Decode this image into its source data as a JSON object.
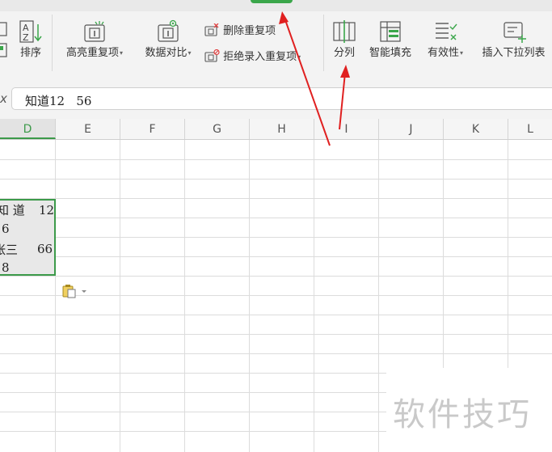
{
  "ribbon": {
    "sort_label": "排序",
    "highlight_dup_label": "高亮重复项",
    "data_compare_label": "数据对比",
    "delete_dup_label": "删除重复项",
    "reject_dup_label": "拒绝录入重复项",
    "split_column_label": "分列",
    "smart_fill_label": "智能填充",
    "validity_label": "有效性",
    "insert_dropdown_label": "插入下拉列表"
  },
  "formula_bar": {
    "fx_label": "x",
    "content": "知道12   56"
  },
  "columns": [
    "D",
    "E",
    "F",
    "G",
    "H",
    "I",
    "J",
    "K",
    "L"
  ],
  "cells": {
    "r1_a": "知 道",
    "r1_b": "12",
    "r2": "6",
    "r3_a": "张三",
    "r3_b": "66",
    "r4": "8"
  },
  "watermark": "软件技巧",
  "colors": {
    "accent_green": "#3c9a4a",
    "arrow_red": "#e02020"
  }
}
